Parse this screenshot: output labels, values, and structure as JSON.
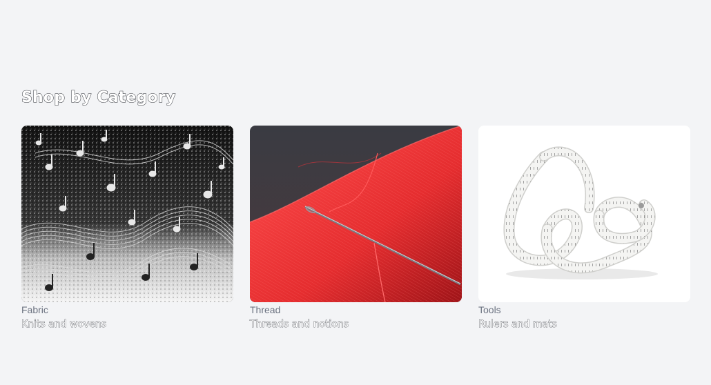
{
  "section": {
    "title": "Shop by Category"
  },
  "categories": [
    {
      "label": "Fabric",
      "subtitle": "Knits and wovens",
      "image": "music-notes-fabric"
    },
    {
      "label": "Thread",
      "subtitle": "Threads and notions",
      "image": "red-thread-spool-needle"
    },
    {
      "label": "Tools",
      "subtitle": "Rulers and mats",
      "image": "measuring-tape"
    }
  ]
}
